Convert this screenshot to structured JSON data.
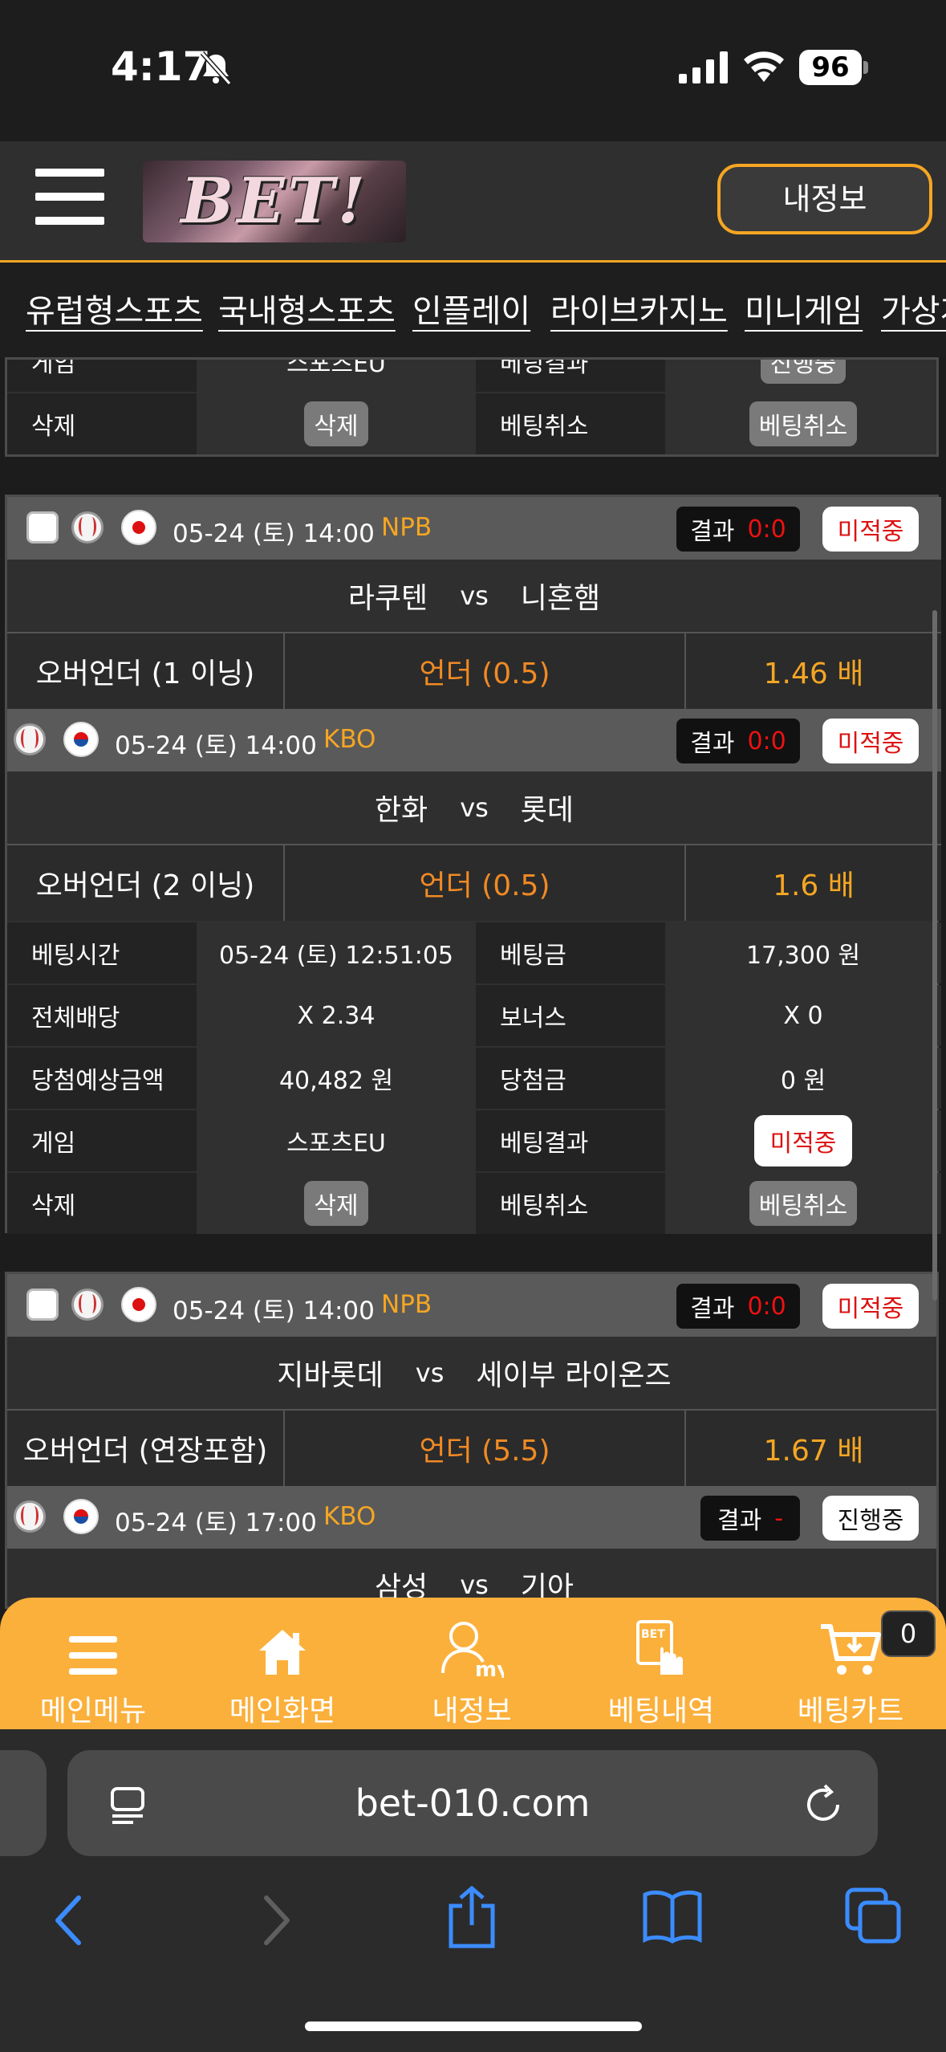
{
  "status_bar": {
    "time": "4:17",
    "battery": "96"
  },
  "header": {
    "logo_text": "BET!",
    "myinfo_button": "내정보"
  },
  "nav": [
    "유럽형스포츠",
    "국내형스포츠",
    "인플레이",
    "라이브카지노",
    "미니게임",
    "가상게임"
  ],
  "partial_card": {
    "rows": [
      {
        "label": "게임",
        "value": "스포츠EU",
        "label2": "베팅결과",
        "value2": "진행중"
      },
      {
        "label": "삭제",
        "value": "삭제",
        "label2": "베팅취소",
        "value2": "베팅취소"
      }
    ]
  },
  "card1": {
    "match1": {
      "date": "05-24 (토) 14:00",
      "league": "NPB",
      "result_label": "결과",
      "result_score": "0:0",
      "status": "미적중",
      "home": "라쿠텐",
      "vs": "vs",
      "away": "니혼햄",
      "market": "오버언더 (1 이닝)",
      "pick": "언더 (0.5)",
      "odds": "1.46 배"
    },
    "match2": {
      "date": "05-24 (토) 14:00",
      "league": "KBO",
      "result_label": "결과",
      "result_score": "0:0",
      "status": "미적중",
      "home": "한화",
      "vs": "vs",
      "away": "롯데",
      "market": "오버언더 (2 이닝)",
      "pick": "언더 (0.5)",
      "odds": "1.6 배"
    },
    "info": {
      "bet_time_label": "베팅시간",
      "bet_time": "05-24 (토) 12:51:05",
      "bet_amount_label": "베팅금",
      "bet_amount": "17,300 원",
      "total_odds_label": "전체배당",
      "total_odds": "X 2.34",
      "bonus_label": "보너스",
      "bonus": "X 0",
      "expected_label": "당첨예상금액",
      "expected": "40,482 원",
      "win_label": "당첨금",
      "win": "0 원",
      "game_label": "게임",
      "game": "스포츠EU",
      "result_label": "베팅결과",
      "result": "미적중",
      "delete_label": "삭제",
      "delete_btn": "삭제",
      "cancel_label": "베팅취소",
      "cancel_btn": "베팅취소"
    }
  },
  "card2": {
    "match1": {
      "date": "05-24 (토) 14:00",
      "league": "NPB",
      "result_label": "결과",
      "result_score": "0:0",
      "status": "미적중",
      "home": "지바롯데",
      "vs": "vs",
      "away": "세이부 라이온즈",
      "market": "오버언더 (연장포함)",
      "pick": "언더 (5.5)",
      "odds": "1.67 배"
    },
    "match2": {
      "date": "05-24 (토) 17:00",
      "league": "KBO",
      "result_label": "결과",
      "result_score": "-",
      "status": "진행중",
      "home": "삼성",
      "vs": "vs",
      "away": "기아"
    }
  },
  "toolbar": {
    "items": [
      "메인메뉴",
      "메인화면",
      "내정보",
      "베팅내역",
      "베팅카트"
    ],
    "cart_count": "0"
  },
  "safari": {
    "url": "bet-010.com"
  }
}
